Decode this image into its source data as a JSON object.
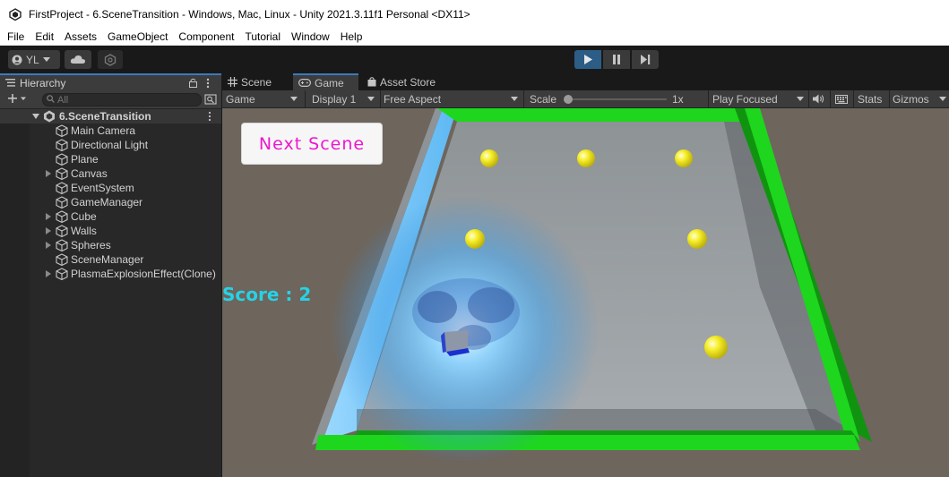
{
  "window": {
    "title": "FirstProject - 6.SceneTransition - Windows, Mac, Linux - Unity 2021.3.11f1 Personal <DX11>"
  },
  "menu": [
    "File",
    "Edit",
    "Assets",
    "GameObject",
    "Component",
    "Tutorial",
    "Window",
    "Help"
  ],
  "toolbar": {
    "account_label": "YL"
  },
  "hierarchy": {
    "tab_label": "Hierarchy",
    "search_placeholder": "All",
    "scene_name": "6.SceneTransition",
    "items": [
      {
        "label": "Main Camera",
        "expandable": false
      },
      {
        "label": "Directional Light",
        "expandable": false
      },
      {
        "label": "Plane",
        "expandable": false
      },
      {
        "label": "Canvas",
        "expandable": true
      },
      {
        "label": "EventSystem",
        "expandable": false
      },
      {
        "label": "GameManager",
        "expandable": false
      },
      {
        "label": "Cube",
        "expandable": true
      },
      {
        "label": "Walls",
        "expandable": true
      },
      {
        "label": "Spheres",
        "expandable": true
      },
      {
        "label": "SceneManager",
        "expandable": false
      },
      {
        "label": "PlasmaExplosionEffect(Clone)",
        "expandable": true
      }
    ]
  },
  "tabs": {
    "scene": "Scene",
    "game": "Game",
    "asset_store": "Asset Store"
  },
  "game_toolbar": {
    "view": "Game",
    "display": "Display 1",
    "aspect": "Free Aspect",
    "scale_label": "Scale",
    "scale_value": "1x",
    "play_mode": "Play Focused",
    "stats": "Stats",
    "gizmos": "Gizmos"
  },
  "game_view": {
    "next_scene_button": "Next Scene",
    "score_text": "Score : 2"
  },
  "colors": {
    "play_active": "#2c5d87",
    "wall_green": "#1ed61e",
    "score_cyan": "#26d2e6",
    "button_text_magenta": "#ee16ce",
    "sphere_yellow": "#f4ec1e",
    "cube_blue": "#2340c0"
  }
}
